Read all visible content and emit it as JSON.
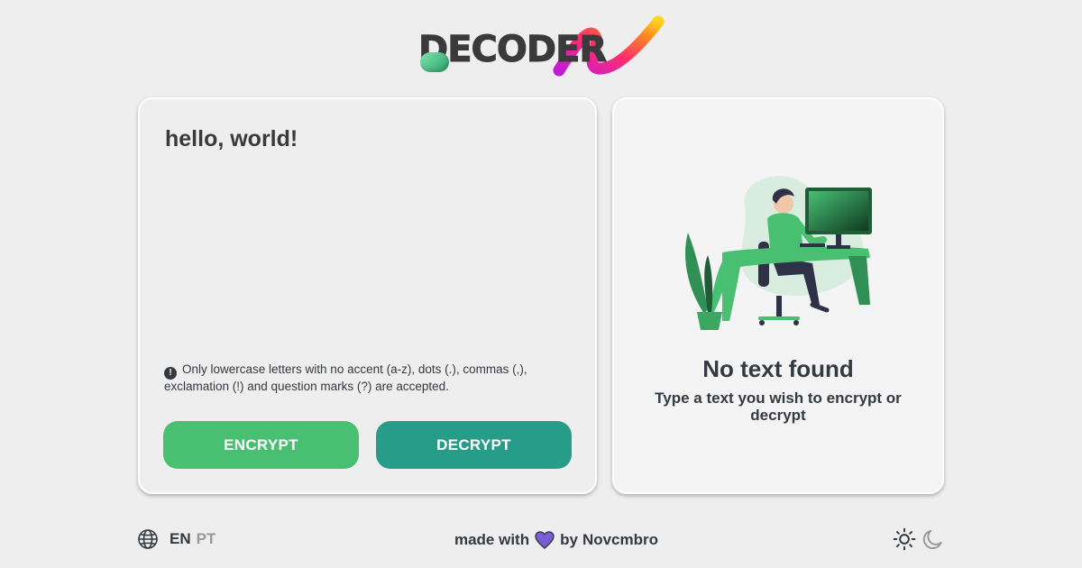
{
  "app": {
    "logo_text": "DECODER"
  },
  "input": {
    "value": "hello, world!",
    "notice_icon": "!",
    "notice_text": "Only lowercase letters with no accent (a-z), dots (.), commas (,), exclamation (!) and question marks (?) are accepted.",
    "encrypt_label": "ENCRYPT",
    "decrypt_label": "DECRYPT"
  },
  "output": {
    "title": "No text found",
    "subtitle": "Type a text you wish to encrypt or decrypt",
    "illustration": "person-at-desk-illustration"
  },
  "footer": {
    "lang_icon": "globe-icon",
    "languages": [
      "EN",
      "PT"
    ],
    "active_language": "EN",
    "credit_prefix": "made with",
    "credit_heart": "heart-icon",
    "credit_by": "by",
    "credit_author": "Novcmbro",
    "theme_icons": [
      "sun-icon",
      "moon-icon"
    ]
  },
  "colors": {
    "background": "#eeeeee",
    "encrypt": "#48bf71",
    "decrypt": "#279d89",
    "text": "#343a40",
    "heart": "#7a5cd6",
    "illustration_green": "#48bf71"
  }
}
